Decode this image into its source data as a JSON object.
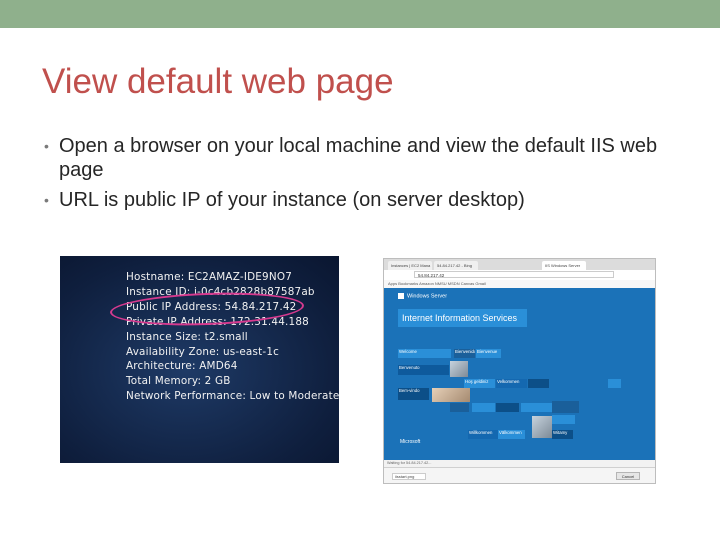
{
  "slide": {
    "title": "View default web page",
    "bullets": [
      "Open a browser on your local machine and view the default IIS web page",
      "URL is public IP of your instance (on server desktop)"
    ],
    "bullet_glyph": "•",
    "accent_color": "#c0504d",
    "topbar_color": "#8fb08c"
  },
  "desktop_info": {
    "lines": [
      "Hostname: EC2AMAZ-IDE9NO7",
      "Instance ID: i-0c4cb2828b87587ab",
      "Public IP Address: 54.84.217.42",
      "Private IP Address: 172.31.44.188",
      "Instance Size: t2.small",
      "Availability Zone: us-east-1c",
      "Architecture: AMD64",
      "Total Memory: 2 GB",
      "Network Performance: Low to Moderate"
    ],
    "highlight_color": "#d63a8f"
  },
  "browser": {
    "tabs": [
      "Instances | EC2 Mana",
      "IIS Windows Server",
      "54.84.217.42 - Bing"
    ],
    "active_tab": "IIS Windows Server",
    "address": "54.84.217.42",
    "bookmarks": "Apps  Bookmarks  Amazon  NMSU  MSDN  Canvas  Gmail",
    "page": {
      "server_label": "Windows Server",
      "title": "Internet Information Services",
      "tiles": [
        "Welcome",
        "Bienvenido",
        "Bienvenue",
        "Benvenuto",
        "Hoş geldiniz",
        "Velkommen",
        "Bem-vindo",
        "Willkommen",
        "Välkommen",
        "Witamy"
      ],
      "footer": "Microsoft"
    },
    "status": "Waiting for 54.84.217.42...",
    "download": "iisstart.png",
    "cancel": "Cancel"
  }
}
